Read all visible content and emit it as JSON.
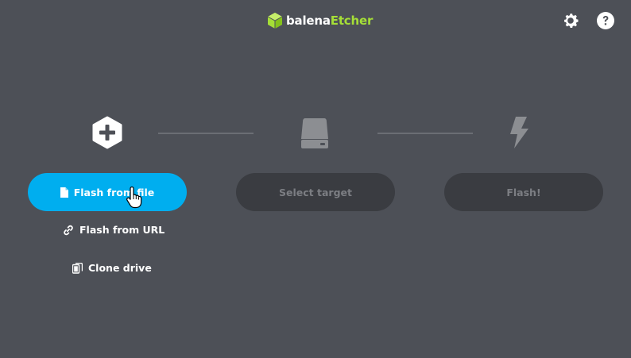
{
  "header": {
    "logo_part1": "balena",
    "logo_part2": "Etcher",
    "brand_color": "#a5de37",
    "settings_icon": "gear-icon",
    "help_icon": "question-circle-icon"
  },
  "steps": {
    "source": {
      "icon": "plus-hexagon-icon",
      "button_label": "Flash from file",
      "button_icon": "file-icon",
      "alt_options": [
        {
          "label": "Flash from URL",
          "icon": "link-icon"
        },
        {
          "label": "Clone drive",
          "icon": "copy-icon"
        }
      ]
    },
    "target": {
      "icon": "drive-icon",
      "button_label": "Select target"
    },
    "flash": {
      "icon": "lightning-icon",
      "button_label": "Flash!"
    }
  },
  "colors": {
    "background": "#4d5057",
    "primary": "#00aeef",
    "disabled_bg": "#3a3c41",
    "disabled_text": "#7c7e83"
  }
}
